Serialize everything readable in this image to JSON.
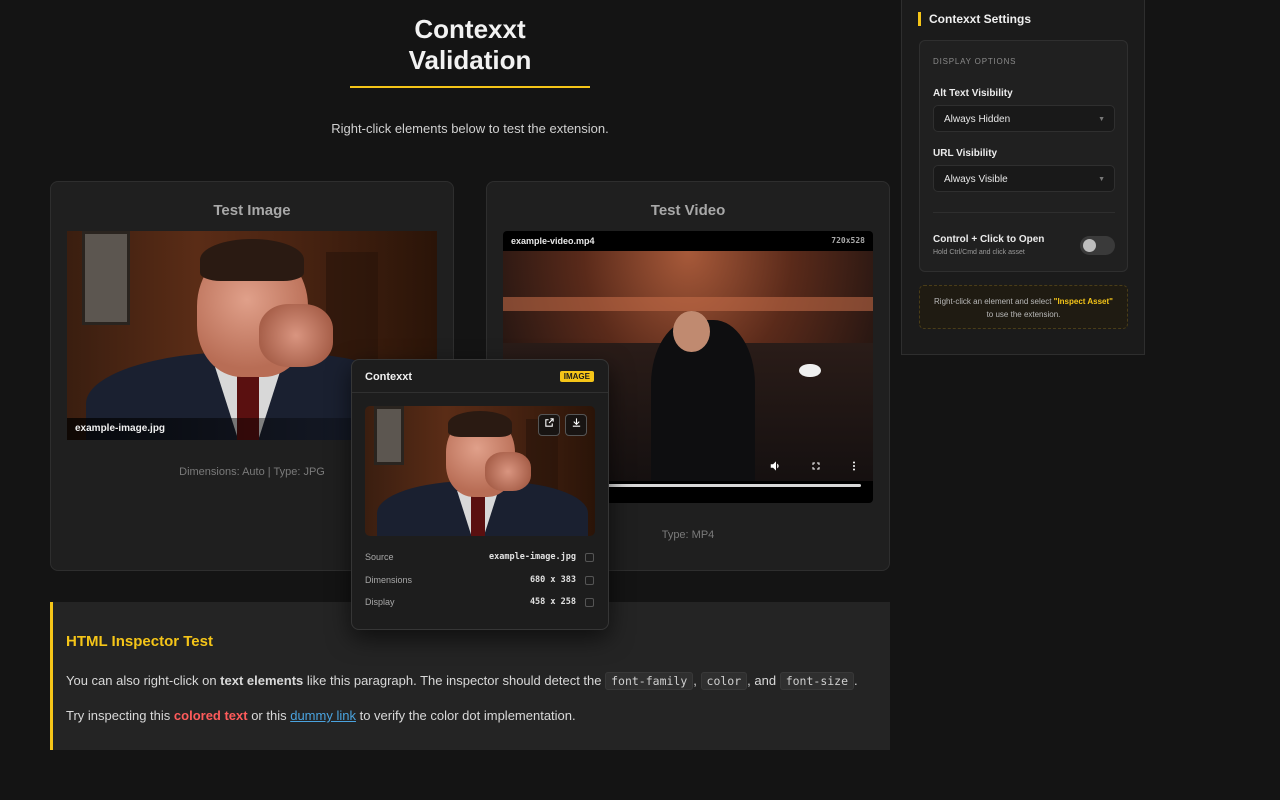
{
  "page": {
    "title": "Contexxt Validation",
    "subtitle": "Right-click elements below to test the extension."
  },
  "image_card": {
    "title": "Test Image",
    "caption": "example-image.jpg",
    "meta": "Dimensions: Auto | Type: JPG"
  },
  "video_card": {
    "title": "Test Video",
    "filename": "example-video.mp4",
    "resolution": "720x528",
    "meta": "Type: MP4",
    "controls": {
      "volume_icon": "volume-icon",
      "fullscreen_icon": "fullscreen-icon",
      "more_icon": "more-vert-icon"
    }
  },
  "inspector": {
    "heading": "HTML Inspector Test",
    "p1_before": "You can also right-click on ",
    "p1_bold": "text elements",
    "p1_middle": " like this paragraph. The inspector should detect the ",
    "code1": "font-family",
    "sep1": ",",
    "code2": "color",
    "sep2": ", and",
    "code3": "font-size",
    "end": ".",
    "p2_before": "Try inspecting this ",
    "p2_colored": "colored text",
    "p2_middle": " or this ",
    "p2_link": "dummy link",
    "p2_after": " to verify the color dot implementation.",
    "accent_color": "#f5c518",
    "colored_text_color": "#ff5b5b",
    "link_color": "#4aa3df"
  },
  "popup": {
    "title": "Contexxt",
    "badge": "IMAGE",
    "rows": [
      {
        "key": "Source",
        "value": "example-image.jpg"
      },
      {
        "key": "Dimensions",
        "value": "680 x 383"
      },
      {
        "key": "Display",
        "value": "458 x 258"
      }
    ],
    "actions": {
      "open_icon": "external-link-icon",
      "download_icon": "download-icon"
    }
  },
  "settings": {
    "title": "Contexxt Settings",
    "section": "DISPLAY OPTIONS",
    "alt_label": "Alt Text Visibility",
    "alt_value": "Always Hidden",
    "url_label": "URL Visibility",
    "url_value": "Always Visible",
    "toggle_label": "Control + Click to Open",
    "toggle_hint": "Hold Ctrl/Cmd and click asset",
    "toggle_on": false,
    "tip_before": "Right-click an element and select ",
    "tip_highlight": "\"Inspect Asset\"",
    "tip_after": " to use the extension."
  }
}
